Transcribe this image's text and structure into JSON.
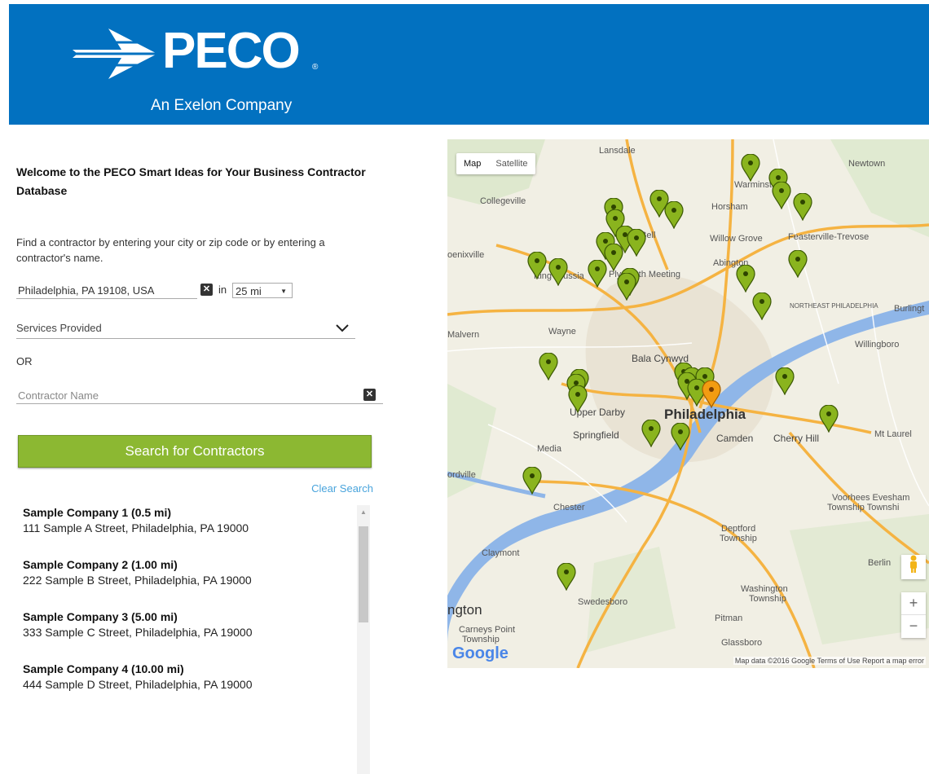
{
  "header": {
    "logo_text": "PECO",
    "registered": "®",
    "tagline": "An Exelon Company",
    "bg_color": "#0271c0"
  },
  "search": {
    "welcome": "Welcome to the PECO Smart Ideas for Your Business Contractor Database",
    "instructions": "Find a contractor by entering your city or zip code or by entering a contractor's name.",
    "location_value": "Philadelphia, PA 19108, USA",
    "in_label": "in",
    "distance_value": "25 mi",
    "services_placeholder": "Services Provided",
    "or_label": "OR",
    "contractor_placeholder": "Contractor Name",
    "search_button": "Search for Contractors",
    "clear_link": "Clear Search",
    "button_color": "#8cb832",
    "link_color": "#49a4dc"
  },
  "results": [
    {
      "name": "Sample Company 1 (0.5 mi)",
      "address": "111 Sample A Street, Philadelphia,  PA 19000"
    },
    {
      "name": "Sample Company 2 (1.00 mi)",
      "address": "222 Sample B Street, Philadelphia,  PA 19000"
    },
    {
      "name": "Sample Company 3 (5.00 mi)",
      "address": "333 Sample C Street, Philadelphia,  PA 19000"
    },
    {
      "name": "Sample Company 4 (10.00 mi)",
      "address": "444 Sample D Street, Philadelphia,  PA 19000"
    }
  ],
  "map": {
    "type_buttons": [
      "Map",
      "Satellite"
    ],
    "active_type": "Map",
    "places": {
      "lansdale": "Lansdale",
      "newtown": "Newtown",
      "warminster": "Warminster",
      "collegeville": "Collegeville",
      "horsham": "Horsham",
      "blue_bell": "Blue Bell",
      "willow_grove": "Willow Grove",
      "feasterville": "Feasterville-Trevose",
      "phoenixville": "oenixville",
      "abington": "Abington",
      "king_prussia": "King Prussia",
      "plymouth_meeting": "Plymouth Meeting",
      "northeast_phila": "NORTHEAST PHILADELPHIA",
      "burlington": "Burlingt",
      "malvern": "Malvern",
      "wayne": "Wayne",
      "willingboro": "Willingboro",
      "bala_cynwyd": "Bala Cynwyd",
      "upper_darby": "Upper Darby",
      "philadelphia": "Philadelphia",
      "springfield": "Springfield",
      "camden": "Camden",
      "cherry_hill": "Cherry Hill",
      "mt_laurel": "Mt Laurel",
      "media": "Media",
      "ordville": "ordville",
      "chester": "Chester",
      "voorhees": "Voorhees Evesham",
      "voorhees2": "Township Townshi",
      "deptford": "Deptford",
      "deptford2": "Township",
      "claymont": "Claymont",
      "berlin": "Berlin",
      "washington": "Washington",
      "washington2": "Township",
      "swedesboro": "Swedesboro",
      "wilmington": "ngton",
      "pitman": "Pitman",
      "carneys": "Carneys Point",
      "carneys2": "Township",
      "glassboro": "Glassboro"
    },
    "google": "Google",
    "attribution": "Map data ©2016 Google   Terms of Use   Report a map error",
    "zoom_in": "+",
    "zoom_out": "−",
    "pin_color": "#8ab41e"
  }
}
